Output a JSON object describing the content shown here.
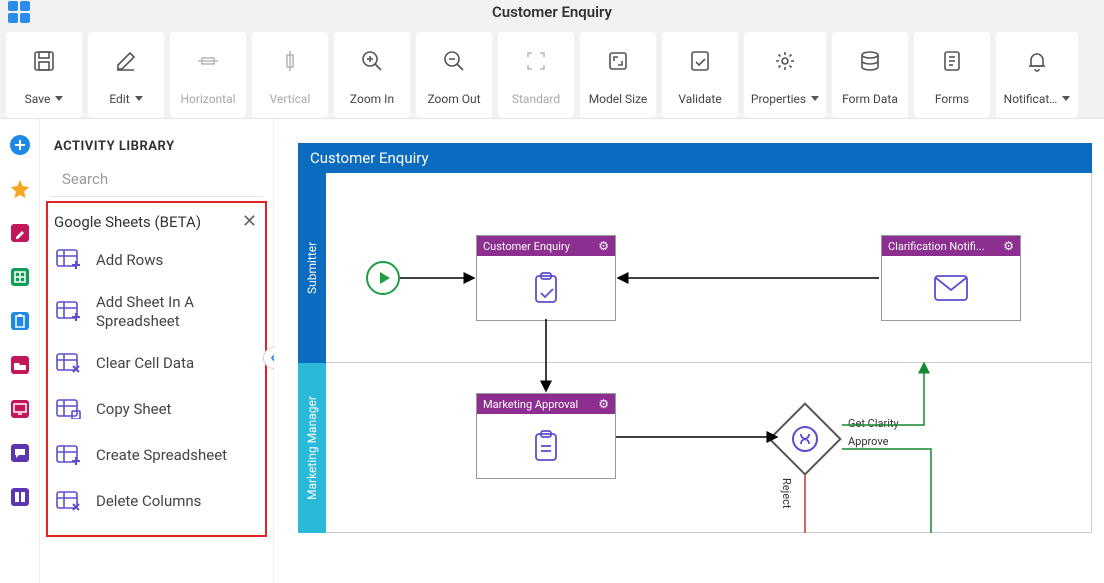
{
  "page_title": "Customer Enquiry",
  "toolbar": [
    {
      "id": "save",
      "label": "Save",
      "caret": true,
      "enabled": true,
      "icon": "save"
    },
    {
      "id": "edit",
      "label": "Edit",
      "caret": true,
      "enabled": true,
      "icon": "edit"
    },
    {
      "id": "horizontal",
      "label": "Horizontal",
      "caret": false,
      "enabled": false,
      "icon": "align-h"
    },
    {
      "id": "vertical",
      "label": "Vertical",
      "caret": false,
      "enabled": false,
      "icon": "align-v"
    },
    {
      "id": "zoom-in",
      "label": "Zoom In",
      "caret": false,
      "enabled": true,
      "icon": "zoom-in"
    },
    {
      "id": "zoom-out",
      "label": "Zoom Out",
      "caret": false,
      "enabled": true,
      "icon": "zoom-out"
    },
    {
      "id": "standard",
      "label": "Standard",
      "caret": false,
      "enabled": false,
      "icon": "fit"
    },
    {
      "id": "model-size",
      "label": "Model Size",
      "caret": false,
      "enabled": true,
      "icon": "model-size"
    },
    {
      "id": "validate",
      "label": "Validate",
      "caret": false,
      "enabled": true,
      "icon": "validate"
    },
    {
      "id": "properties",
      "label": "Properties",
      "caret": true,
      "enabled": true,
      "icon": "properties"
    },
    {
      "id": "form-data",
      "label": "Form Data",
      "caret": false,
      "enabled": true,
      "icon": "form-data"
    },
    {
      "id": "forms",
      "label": "Forms",
      "caret": false,
      "enabled": true,
      "icon": "forms"
    },
    {
      "id": "notifications",
      "label": "Notificat…",
      "caret": true,
      "enabled": true,
      "icon": "bell"
    }
  ],
  "rail_icons": [
    "add",
    "star",
    "edit-note",
    "sheets",
    "clipboard",
    "folder",
    "monitor",
    "chat",
    "columns"
  ],
  "library": {
    "title": "ACTIVITY LIBRARY",
    "search_placeholder": "Search",
    "group_name": "Google Sheets (BETA)",
    "items": [
      {
        "id": "add-rows",
        "label": "Add Rows"
      },
      {
        "id": "add-sheet",
        "label": "Add Sheet In A Spreadsheet"
      },
      {
        "id": "clear-cell",
        "label": "Clear Cell Data"
      },
      {
        "id": "copy-sheet",
        "label": "Copy Sheet"
      },
      {
        "id": "create-ss",
        "label": "Create Spreadsheet"
      },
      {
        "id": "delete-cols",
        "label": "Delete Columns"
      }
    ]
  },
  "diagram": {
    "title": "Customer Enquiry",
    "lanes": [
      "Submitter",
      "Marketing Manager"
    ],
    "tasks": {
      "customer_enquiry": "Customer Enquiry",
      "clarification": "Clarification Notifi...",
      "marketing_approval": "Marketing Approval"
    },
    "edge_labels": {
      "get_clarity": "Get Clarity",
      "approve": "Approve",
      "reject": "Reject"
    }
  }
}
